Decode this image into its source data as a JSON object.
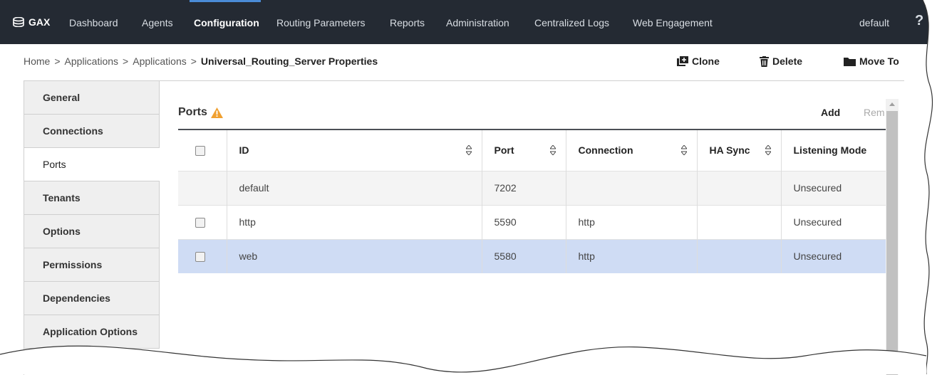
{
  "nav": {
    "brand": "GAX",
    "items": [
      "Dashboard",
      "Agents",
      "Configuration",
      "Routing Parameters",
      "Reports",
      "Administration",
      "Centralized Logs",
      "Web Engagement"
    ],
    "active": "Configuration",
    "user": "default",
    "help": "?"
  },
  "breadcrumb": {
    "items": [
      "Home",
      "Applications",
      "Applications"
    ],
    "separator": ">",
    "current": "Universal_Routing_Server Properties"
  },
  "toolbar": {
    "clone": "Clone",
    "delete": "Delete",
    "move_to": "Move To"
  },
  "sidebar": {
    "items": [
      "General",
      "Connections",
      "Ports",
      "Tenants",
      "Options",
      "Permissions",
      "Dependencies",
      "Application Options"
    ],
    "active": "Ports"
  },
  "ports": {
    "title": "Ports",
    "add": "Add",
    "remove": "Rem",
    "columns": [
      "ID",
      "Port",
      "Connection",
      "HA Sync",
      "Listening Mode"
    ],
    "rows": [
      {
        "id": "default",
        "port": "7202",
        "connection": "",
        "ha_sync": "",
        "listening_mode": "Unsecured",
        "checkbox": false
      },
      {
        "id": "http",
        "port": "5590",
        "connection": "http",
        "ha_sync": "",
        "listening_mode": "Unsecured",
        "checkbox": true
      },
      {
        "id": "web",
        "port": "5580",
        "connection": "http",
        "ha_sync": "",
        "listening_mode": "Unsecured",
        "checkbox": true,
        "selected": true
      }
    ]
  },
  "colors": {
    "nav_bg": "#242a33",
    "accent": "#4a8bd6",
    "selected_row": "#cfdcf4",
    "warning": "#f0a030"
  }
}
